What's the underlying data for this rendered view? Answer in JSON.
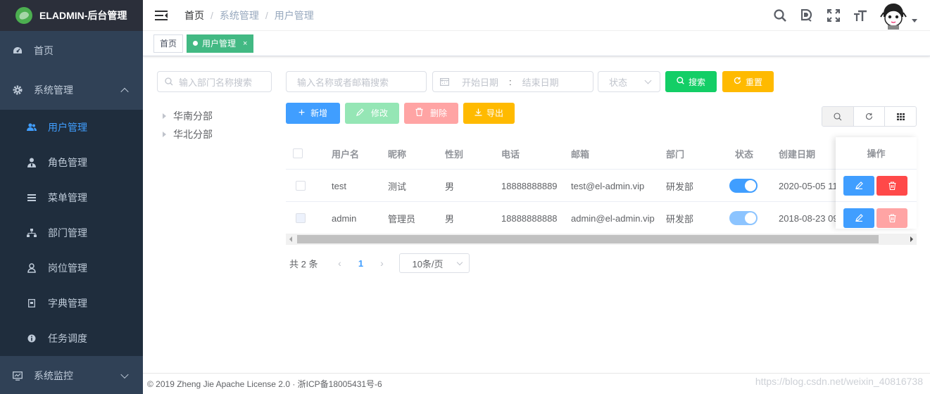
{
  "app": {
    "title": "ELADMIN-后台管理"
  },
  "sidebar": {
    "items": [
      {
        "label": "首页",
        "icon": "dashboard-icon"
      },
      {
        "label": "系统管理",
        "icon": "gear-icon"
      }
    ],
    "submenu": [
      {
        "label": "用户管理",
        "icon": "users-icon",
        "active": true
      },
      {
        "label": "角色管理",
        "icon": "role-icon"
      },
      {
        "label": "菜单管理",
        "icon": "menu-icon"
      },
      {
        "label": "部门管理",
        "icon": "dept-icon"
      },
      {
        "label": "岗位管理",
        "icon": "post-icon"
      },
      {
        "label": "字典管理",
        "icon": "dict-icon"
      },
      {
        "label": "任务调度",
        "icon": "task-icon"
      }
    ],
    "monitor": {
      "label": "系统监控",
      "icon": "monitor-icon"
    }
  },
  "breadcrumb": [
    "首页",
    "系统管理",
    "用户管理"
  ],
  "breadcrumb_sep": "/",
  "tags": {
    "home": "首页",
    "active": "用户管理",
    "close": "×"
  },
  "dept": {
    "search_placeholder": "输入部门名称搜索",
    "tree": [
      "华南分部",
      "华北分部"
    ]
  },
  "filters": {
    "keyword_placeholder": "输入名称或者邮箱搜索",
    "start_date": "开始日期",
    "date_sep": ":",
    "end_date": "结束日期",
    "status_placeholder": "状态",
    "search_btn": "搜索",
    "reset_btn": "重置"
  },
  "actions": {
    "add": "新增",
    "edit": "修改",
    "delete": "删除",
    "export": "导出"
  },
  "table": {
    "headers": {
      "username": "用户名",
      "nickname": "昵称",
      "gender": "性别",
      "phone": "电话",
      "email": "邮箱",
      "dept": "部门",
      "status": "状态",
      "created": "创建日期",
      "ops": "操作"
    },
    "rows": [
      {
        "username": "test",
        "nickname": "测试",
        "gender": "男",
        "phone": "18888888889",
        "email": "test@el-admin.vip",
        "dept": "研发部",
        "enabled": true,
        "created": "2020-05-05 11:"
      },
      {
        "username": "admin",
        "nickname": "管理员",
        "gender": "男",
        "phone": "18888888888",
        "email": "admin@el-admin.vip",
        "dept": "研发部",
        "enabled": true,
        "created": "2018-08-23 09:"
      }
    ]
  },
  "pagination": {
    "total": "共 2 条",
    "page": "1",
    "size": "10条/页"
  },
  "footer": {
    "text": "© 2019 Zheng Jie Apache License 2.0 · 浙ICP备18005431号-6"
  },
  "watermark": "https://blog.csdn.net/weixin_40816738",
  "colors": {
    "sidebar": "#304156",
    "submenu": "#1f2d3d",
    "primary": "#409eff",
    "success": "#13ce66",
    "warning": "#ffba00",
    "danger": "#ff4949",
    "tag": "#42b983"
  }
}
